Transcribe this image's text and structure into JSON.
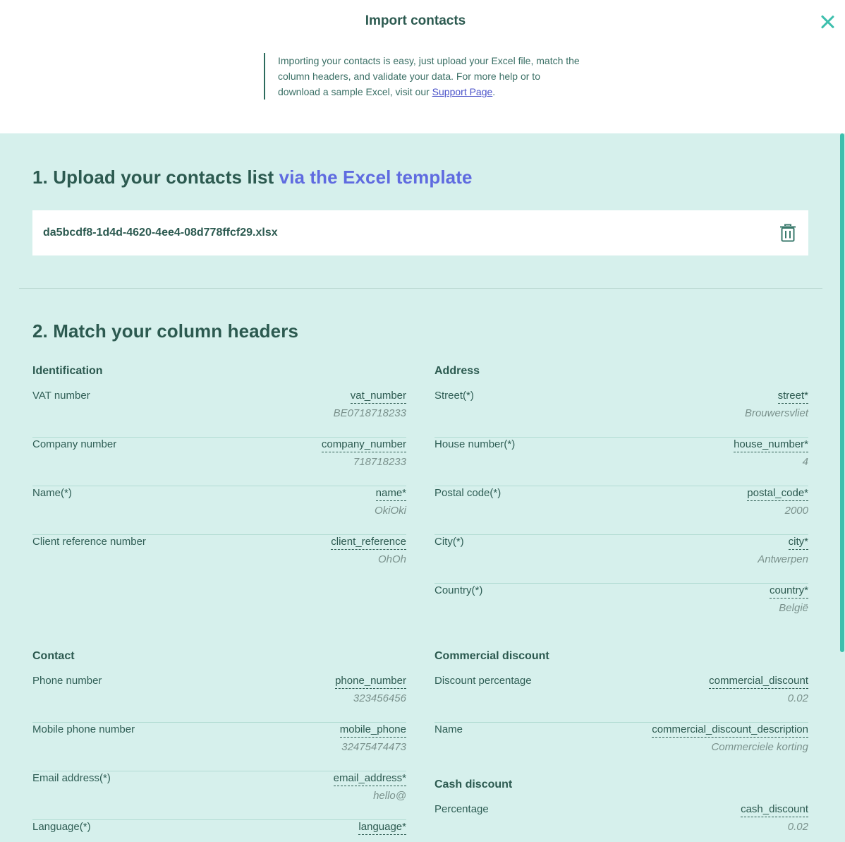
{
  "header": {
    "title": "Import contacts",
    "intro_text": "Importing your contacts is easy, just upload your Excel file, match the column headers, and validate your data. For more help or to download a sample Excel, visit our ",
    "intro_link": "Support Page",
    "intro_end": "."
  },
  "step1": {
    "title": "1. Upload your contacts list ",
    "link": "via the Excel template",
    "file_name": "da5bcdf8-1d4d-4620-4ee4-08d778ffcf29.xlsx"
  },
  "step2": {
    "title": "2. Match your column headers",
    "identification": {
      "title": "Identification",
      "rows": [
        {
          "label": "VAT number",
          "field": "vat_number",
          "sample": "BE0718718233"
        },
        {
          "label": "Company number",
          "field": "company_number",
          "sample": "718718233"
        },
        {
          "label": "Name(*)",
          "field": "name*",
          "sample": "OkiOki"
        },
        {
          "label": "Client reference number",
          "field": "client_reference",
          "sample": "OhOh"
        }
      ]
    },
    "address": {
      "title": "Address",
      "rows": [
        {
          "label": "Street(*)",
          "field": "street*",
          "sample": "Brouwersvliet"
        },
        {
          "label": "House number(*)",
          "field": "house_number*",
          "sample": "4"
        },
        {
          "label": "Postal code(*)",
          "field": "postal_code*",
          "sample": "2000"
        },
        {
          "label": "City(*)",
          "field": "city*",
          "sample": "Antwerpen"
        },
        {
          "label": "Country(*)",
          "field": "country*",
          "sample": "België"
        }
      ]
    },
    "contact": {
      "title": "Contact",
      "rows": [
        {
          "label": "Phone number",
          "field": "phone_number",
          "sample": "323456456"
        },
        {
          "label": "Mobile phone number",
          "field": "mobile_phone",
          "sample": "32475474473"
        },
        {
          "label": "Email address(*)",
          "field": "email_address*",
          "sample": "hello@"
        },
        {
          "label": "Language(*)",
          "field": "language*",
          "sample": ""
        }
      ]
    },
    "commercial_discount": {
      "title": "Commercial discount",
      "rows": [
        {
          "label": "Discount percentage",
          "field": "commercial_discount",
          "sample": "0.02"
        },
        {
          "label": "Name",
          "field": "commercial_discount_description",
          "sample": "Commerciele korting"
        }
      ]
    },
    "cash_discount": {
      "title": "Cash discount",
      "rows": [
        {
          "label": "Percentage",
          "field": "cash_discount",
          "sample": "0.02"
        }
      ]
    }
  },
  "icons": {
    "close": "close-icon",
    "trash": "trash-icon"
  },
  "colors": {
    "accent": "#3dbfad",
    "panel_bg": "#d6f0ec",
    "text": "#2c5a50",
    "link": "#5f6be0"
  }
}
